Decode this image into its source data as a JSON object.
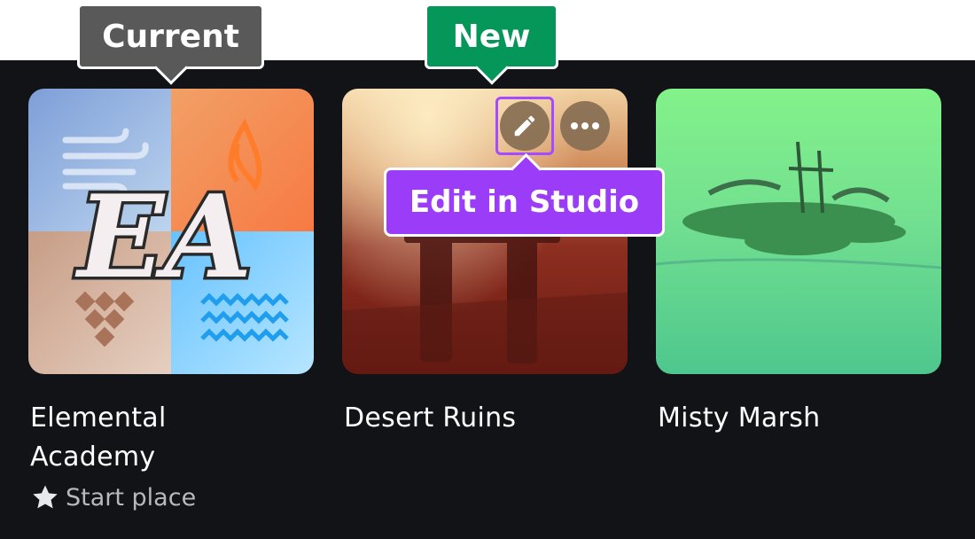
{
  "callouts": {
    "current": "Current",
    "new": "New"
  },
  "tooltip": {
    "label": "Edit in Studio"
  },
  "places": [
    {
      "name": "Elemental Academy",
      "name_line1": "Elemental",
      "name_line2": "Academy",
      "badge": "Start place",
      "thumbnail_text": "EA"
    },
    {
      "name": "Desert Ruins"
    },
    {
      "name": "Misty Marsh"
    }
  ],
  "icons": {
    "edit": "pencil-icon",
    "more": "more-horizontal-icon",
    "start": "star-icon"
  },
  "colors": {
    "background": "#121317",
    "current_badge": "#595959",
    "new_badge": "#05975a",
    "tooltip": "#9b3cf8",
    "highlight_border": "#a54bff"
  }
}
